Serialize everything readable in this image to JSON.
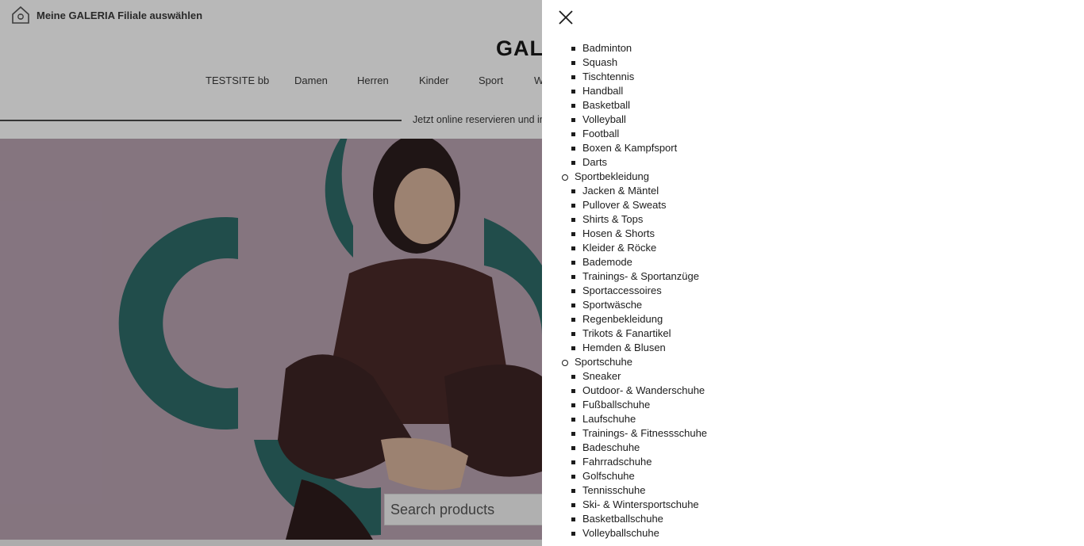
{
  "header": {
    "store_label": "Meine GALERIA Filiale auswählen",
    "logo_visible": "GAL",
    "nav": [
      "TESTSITE bb",
      "Damen",
      "Herren",
      "Kinder",
      "Sport",
      "W"
    ],
    "promo_text": "Jetzt online reservieren und in"
  },
  "search": {
    "placeholder": "Search products"
  },
  "hero": {
    "bg_color": "#b9a2b1",
    "accent_color": "#2e5e5c"
  },
  "drawer": {
    "close_icon": "close-icon",
    "menu": [
      {
        "kind": "sub",
        "label": "Badminton"
      },
      {
        "kind": "sub",
        "label": "Squash"
      },
      {
        "kind": "sub",
        "label": "Tischtennis"
      },
      {
        "kind": "sub",
        "label": "Handball"
      },
      {
        "kind": "sub",
        "label": "Basketball"
      },
      {
        "kind": "sub",
        "label": "Volleyball"
      },
      {
        "kind": "sub",
        "label": "Football"
      },
      {
        "kind": "sub",
        "label": "Boxen & Kampfsport"
      },
      {
        "kind": "sub",
        "label": "Darts"
      },
      {
        "kind": "cat",
        "label": "Sportbekleidung"
      },
      {
        "kind": "sub",
        "label": "Jacken & Mäntel"
      },
      {
        "kind": "sub",
        "label": "Pullover & Sweats"
      },
      {
        "kind": "sub",
        "label": "Shirts & Tops"
      },
      {
        "kind": "sub",
        "label": "Hosen & Shorts"
      },
      {
        "kind": "sub",
        "label": "Kleider & Röcke"
      },
      {
        "kind": "sub",
        "label": "Bademode"
      },
      {
        "kind": "sub",
        "label": "Trainings- & Sportanzüge"
      },
      {
        "kind": "sub",
        "label": "Sportaccessoires"
      },
      {
        "kind": "sub",
        "label": "Sportwäsche"
      },
      {
        "kind": "sub",
        "label": "Regenbekleidung"
      },
      {
        "kind": "sub",
        "label": "Trikots & Fanartikel"
      },
      {
        "kind": "sub",
        "label": "Hemden & Blusen"
      },
      {
        "kind": "cat",
        "label": "Sportschuhe"
      },
      {
        "kind": "sub",
        "label": "Sneaker"
      },
      {
        "kind": "sub",
        "label": "Outdoor- & Wanderschuhe"
      },
      {
        "kind": "sub",
        "label": "Fußballschuhe"
      },
      {
        "kind": "sub",
        "label": "Laufschuhe"
      },
      {
        "kind": "sub",
        "label": "Trainings- & Fitnessschuhe"
      },
      {
        "kind": "sub",
        "label": "Badeschuhe"
      },
      {
        "kind": "sub",
        "label": "Fahrradschuhe"
      },
      {
        "kind": "sub",
        "label": "Golfschuhe"
      },
      {
        "kind": "sub",
        "label": "Tennisschuhe"
      },
      {
        "kind": "sub",
        "label": "Ski- & Wintersportschuhe"
      },
      {
        "kind": "sub",
        "label": "Basketballschuhe"
      },
      {
        "kind": "sub",
        "label": "Volleyballschuhe"
      }
    ]
  }
}
